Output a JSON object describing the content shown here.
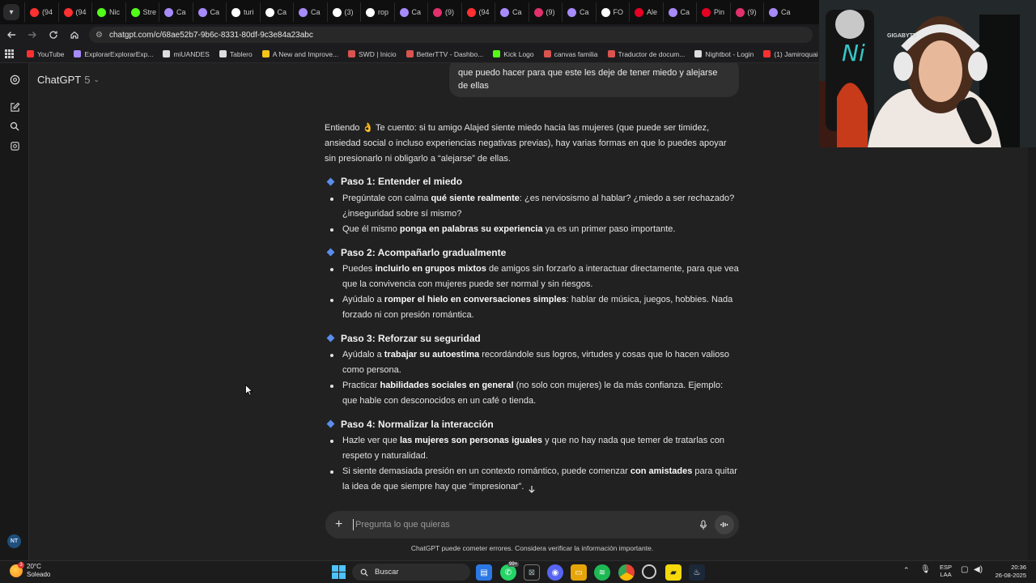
{
  "browser": {
    "tabs": [
      {
        "label": "(94",
        "color": "#ff3030"
      },
      {
        "label": "(94",
        "color": "#ff3030"
      },
      {
        "label": "Nic",
        "color": "#53fc18"
      },
      {
        "label": "Stre",
        "color": "#53fc18"
      },
      {
        "label": "Ca",
        "color": "#a78bfa"
      },
      {
        "label": "Ca",
        "color": "#a78bfa"
      },
      {
        "label": "turi",
        "color": "#ffffff"
      },
      {
        "label": "Ca",
        "color": "#ffffff"
      },
      {
        "label": "Ca",
        "color": "#a78bfa"
      },
      {
        "label": "(3)",
        "color": "#ffffff"
      },
      {
        "label": "rop",
        "color": "#ffffff"
      },
      {
        "label": "Ca",
        "color": "#a78bfa"
      },
      {
        "label": "(9)",
        "color": "#e1306c"
      },
      {
        "label": "(94",
        "color": "#ff3030"
      },
      {
        "label": "Ca",
        "color": "#a78bfa"
      },
      {
        "label": "(9)",
        "color": "#e1306c"
      },
      {
        "label": "Ca",
        "color": "#a78bfa"
      },
      {
        "label": "FO",
        "color": "#ffffff"
      },
      {
        "label": "Ale",
        "color": "#e60023"
      },
      {
        "label": "Ca",
        "color": "#a78bfa"
      },
      {
        "label": "Pin",
        "color": "#e60023"
      },
      {
        "label": "(9)",
        "color": "#e1306c"
      },
      {
        "label": "Ca",
        "color": "#a78bfa"
      }
    ],
    "url": "chatgpt.com/c/68ae52b7-9b6c-8331-80df-9c3e84a23abc",
    "bookmarks": [
      {
        "label": "YouTube",
        "color": "#ff3030"
      },
      {
        "label": "ExplorarExplorarExp...",
        "color": "#a78bfa"
      },
      {
        "label": "miUANDES",
        "color": "#dddddd"
      },
      {
        "label": "Tablero",
        "color": "#dddddd"
      },
      {
        "label": "A New and Improve...",
        "color": "#f5c518"
      },
      {
        "label": "SWD | Inicio",
        "color": "#d9534f"
      },
      {
        "label": "BetterTTV - Dashbo...",
        "color": "#d9534f"
      },
      {
        "label": "Kick Logo",
        "color": "#53fc18"
      },
      {
        "label": "canvas familia",
        "color": "#d9534f"
      },
      {
        "label": "Traductor de docum...",
        "color": "#d9534f"
      },
      {
        "label": "Nightbot - Login",
        "color": "#dddddd"
      },
      {
        "label": "(1) Jamiroquai - Can...",
        "color": "#ff3030"
      }
    ]
  },
  "chat": {
    "model_name": "ChatGPT",
    "model_version": "5",
    "user_message": "que puedo hacer para que este les deje de tener miedo y alejarse de ellas",
    "intro": "Entiendo 👌 Te cuento: si tu amigo Alajed siente miedo hacia las mujeres (que puede ser timidez, ansiedad social o incluso experiencias negativas previas), hay varias formas en que lo puedes apoyar sin presionarlo ni obligarlo a “alejarse” de ellas.",
    "steps": [
      {
        "title": "Paso 1: Entender el miedo",
        "bullets": [
          {
            "pre": "Pregúntale con calma ",
            "bold": "qué siente realmente",
            "post": ": ¿es nerviosismo al hablar? ¿miedo a ser rechazado? ¿inseguridad sobre sí mismo?"
          },
          {
            "pre": "Que él mismo ",
            "bold": "ponga en palabras su experiencia",
            "post": " ya es un primer paso importante."
          }
        ]
      },
      {
        "title": "Paso 2: Acompañarlo gradualmente",
        "bullets": [
          {
            "pre": "Puedes ",
            "bold": "incluirlo en grupos mixtos",
            "post": " de amigos sin forzarlo a interactuar directamente, para que vea que la convivencia con mujeres puede ser normal y sin riesgos."
          },
          {
            "pre": "Ayúdalo a ",
            "bold": "romper el hielo en conversaciones simples",
            "post": ": hablar de música, juegos, hobbies. Nada forzado ni con presión romántica."
          }
        ]
      },
      {
        "title": "Paso 3: Reforzar su seguridad",
        "bullets": [
          {
            "pre": "Ayúdalo a ",
            "bold": "trabajar su autoestima",
            "post": " recordándole sus logros, virtudes y cosas que lo hacen valioso como persona."
          },
          {
            "pre": "Practicar ",
            "bold": "habilidades sociales en general",
            "post": " (no solo con mujeres) le da más confianza. Ejemplo: que hable con desconocidos en un café o tienda."
          }
        ]
      },
      {
        "title": "Paso 4: Normalizar la interacción",
        "bullets": [
          {
            "pre": "Hazle ver que ",
            "bold": "las mujeres son personas iguales",
            "post": " y que no hay nada que temer de tratarlas con respeto y naturalidad."
          },
          {
            "pre": "Si siente demasiada presión en un contexto romántico, puede comenzar ",
            "bold": "con amistades",
            "post": " para quitar la idea de que siempre hay que “impresionar”."
          }
        ]
      }
    ],
    "composer_placeholder": "Pregunta lo que quieras",
    "disclaimer": "ChatGPT puede cometer errores. Considera verificar la información importante.",
    "user_initials": "NT"
  },
  "webcam": {
    "chair_text": "GIGABYTE"
  },
  "taskbar": {
    "temperature": "20°C",
    "condition": "Soleado",
    "weather_badge": "3",
    "search_label": "Buscar",
    "lang_top": "ESP",
    "lang_bottom": "LAA",
    "time": "20:36",
    "date": "26-08-2025",
    "whatsapp_badge": "99+"
  },
  "colors": {
    "accent": "#5b8def",
    "background": "#212121",
    "sidebar": "#181818"
  }
}
